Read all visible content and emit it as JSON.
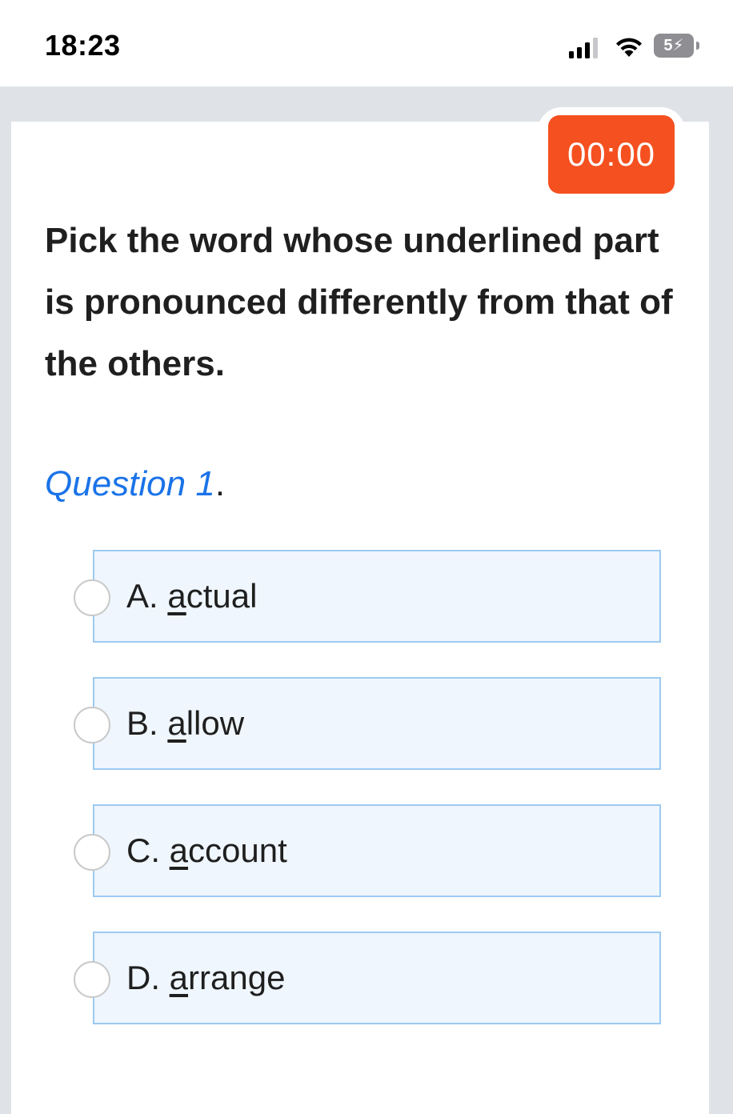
{
  "status_bar": {
    "time": "18:23",
    "battery_level": "5",
    "battery_charging": true,
    "signal_bars_active": 3,
    "signal_bars_total": 4
  },
  "timer": {
    "value": "00:00",
    "color": "#f5501f"
  },
  "instruction": "Pick the word whose underlined part is pronounced differently from that of the others.",
  "question": {
    "label": "Question 1",
    "label_suffix": "."
  },
  "options": [
    {
      "prefix": "A. ",
      "underlined": "a",
      "rest": "ctual"
    },
    {
      "prefix": "B. ",
      "underlined": "a",
      "rest": "llow"
    },
    {
      "prefix": "C. ",
      "underlined": "a",
      "rest": "ccount"
    },
    {
      "prefix": "D. ",
      "underlined": "a",
      "rest": "rrange"
    }
  ],
  "colors": {
    "accent": "#1a73e8",
    "option_bg": "#eff6fd",
    "option_border": "#9ccaf2"
  }
}
